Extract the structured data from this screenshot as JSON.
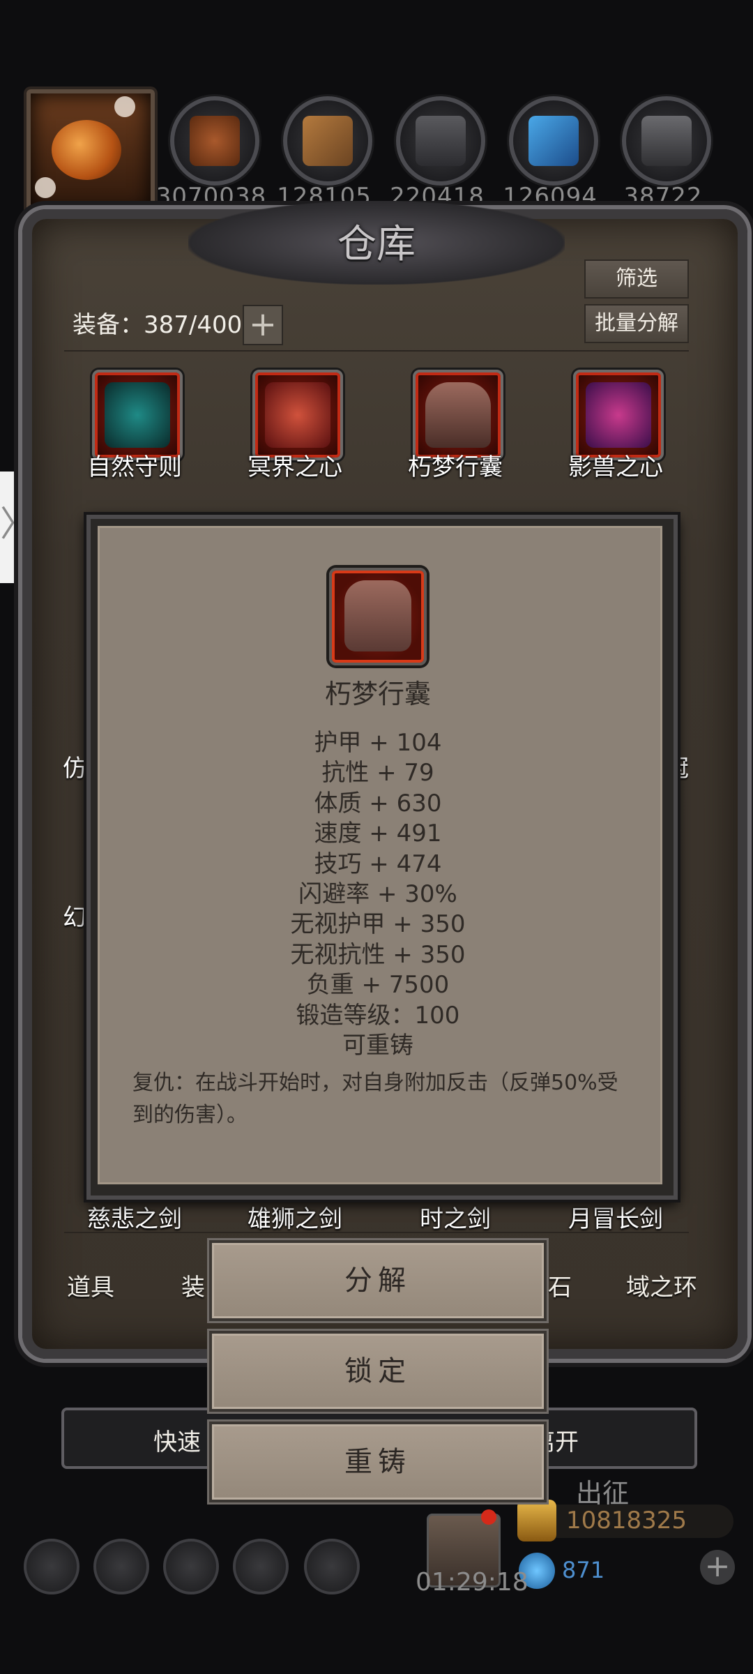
{
  "resources": [
    {
      "icon": "meat-icon",
      "value": "3070038"
    },
    {
      "icon": "wood-icon",
      "value": "128105"
    },
    {
      "icon": "stone-icon",
      "value": "220418"
    },
    {
      "icon": "crystal-icon",
      "value": "126094"
    },
    {
      "icon": "iron-icon",
      "value": "38722"
    }
  ],
  "panel": {
    "title": "仓库",
    "filter_button": "筛选",
    "bulk_button": "批量分解",
    "equip_count": "装备：387/400",
    "plus": "+"
  },
  "items_row1": [
    {
      "name": "自然守则",
      "color": "#1f8a86"
    },
    {
      "name": "冥界之心",
      "color": "#8b1e1e"
    },
    {
      "name": "朽梦行囊",
      "color": "#6b4a40"
    },
    {
      "name": "影兽之心",
      "color": "#6a2e8c"
    }
  ],
  "behind_labels": {
    "left_mid": "仿",
    "right_mid": "冠",
    "left_low": "幻"
  },
  "items_row_bottom": [
    "慈悲之剑",
    "雄狮之剑",
    "时之剑",
    "月冒长剑"
  ],
  "tabs": [
    "道具",
    "装",
    "石",
    "域之环"
  ],
  "quick_bar": {
    "left": "快速",
    "right": "离开"
  },
  "sortie": "出征",
  "gold": "10818325",
  "gems": "871",
  "timer": "01:29:18",
  "tooltip": {
    "name": "朽梦行囊",
    "stats": [
      "护甲 + 104",
      "抗性 + 79",
      "体质 + 630",
      "速度 + 491",
      "技巧 + 474",
      "闪避率 + 30%",
      "无视护甲 + 350",
      "无视抗性 + 350",
      "负重 + 7500",
      "锻造等级：100",
      "可重铸"
    ],
    "description": "复仇：在战斗开始时，对自身附加反击（反弹50%受到的伤害）。"
  },
  "actions": {
    "decompose": "分解",
    "lock": "锁定",
    "reforge": "重铸"
  },
  "side_handle": "〉"
}
